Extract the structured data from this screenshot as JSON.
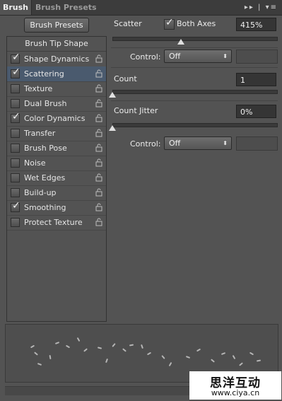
{
  "tabs": {
    "active": "Brush",
    "inactive": "Brush Presets",
    "icons": "▸▸ | ▾≡"
  },
  "preset_button": "Brush Presets",
  "tip_shape": "Brush Tip Shape",
  "options": [
    {
      "label": "Shape Dynamics",
      "checked": true
    },
    {
      "label": "Scattering",
      "checked": true,
      "selected": true
    },
    {
      "label": "Texture",
      "checked": false
    },
    {
      "label": "Dual Brush",
      "checked": false
    },
    {
      "label": "Color Dynamics",
      "checked": true
    },
    {
      "label": "Transfer",
      "checked": false
    },
    {
      "label": "Brush Pose",
      "checked": false
    },
    {
      "label": "Noise",
      "checked": false
    },
    {
      "label": "Wet Edges",
      "checked": false
    },
    {
      "label": "Build-up",
      "checked": false
    },
    {
      "label": "Smoothing",
      "checked": true
    },
    {
      "label": "Protect Texture",
      "checked": false
    }
  ],
  "scatter": {
    "label": "Scatter",
    "both_axes": "Both Axes",
    "both_axes_checked": true,
    "value": "415%",
    "slider": 0.42
  },
  "control1": {
    "label": "Control:",
    "value": "Off"
  },
  "count": {
    "label": "Count",
    "value": "1",
    "slider": 0.0
  },
  "count_jitter": {
    "label": "Count Jitter",
    "value": "0%",
    "slider": 0.0
  },
  "control2": {
    "label": "Control:",
    "value": "Off"
  },
  "watermark": {
    "line1": "思洋互动",
    "line2": "www.ciya.cn"
  }
}
